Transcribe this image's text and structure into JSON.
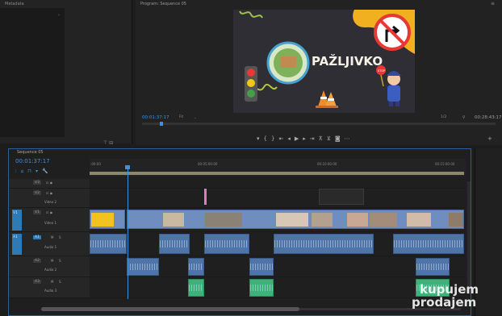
{
  "left_panel": {
    "tab": "Metadata"
  },
  "program": {
    "title": "Program: Sequence 05",
    "timecode_current": "00:01:37:17",
    "fit": "Fit",
    "resolution": "1/2",
    "timecode_duration": "00:28:43:17",
    "frame_text": "PAŽLJIVKO",
    "stop_text": "STOP"
  },
  "timeline": {
    "tab": "Sequence 05",
    "timecode": "00:01:37:17",
    "ruler_marks": [
      ":00:00",
      "00:05:00:00",
      "00:10:00:00",
      "00:15:00:00"
    ],
    "tracks_video": [
      {
        "code": "V3",
        "name": ""
      },
      {
        "code": "V2",
        "name": "Video 2"
      },
      {
        "code": "V1",
        "name": "Video 1"
      }
    ],
    "tracks_audio": [
      {
        "code": "A1",
        "name": "Audio 1"
      },
      {
        "code": "A2",
        "name": "Audio 2"
      },
      {
        "code": "A3",
        "name": "Audio 3"
      }
    ],
    "mute_label": "M",
    "solo_label": "S",
    "source_v": "V1",
    "source_a": "A1"
  },
  "watermark": {
    "line1": "kupujem",
    "line2": "prodajem"
  },
  "colors": {
    "accent": "#3d8fe0",
    "video_clip": "#6f8ebf",
    "audio_clip": "#4e74a8",
    "audio_green": "#3bb37a"
  }
}
